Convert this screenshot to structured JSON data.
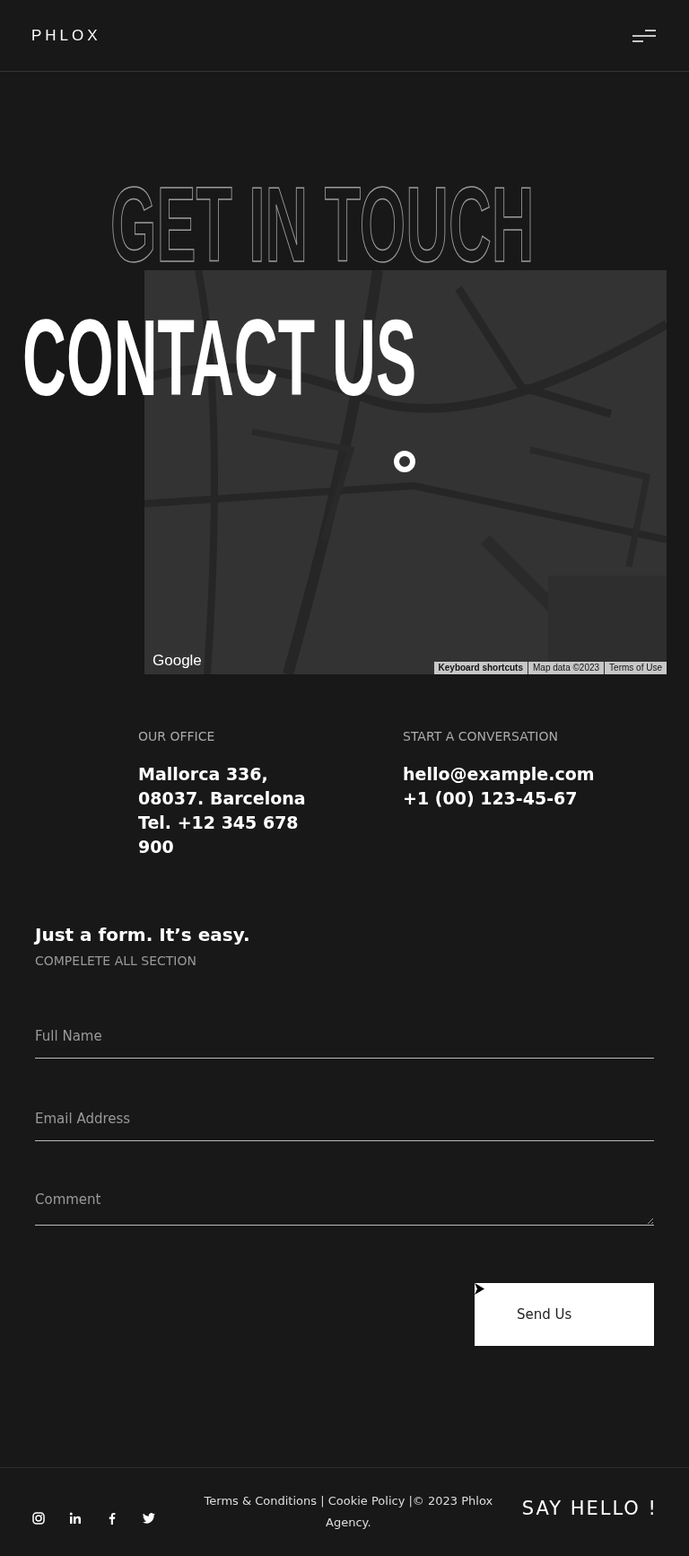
{
  "header": {
    "logo": "PHLOX"
  },
  "hero": {
    "outline_title": "GET IN TOUCH",
    "title": "CONTACT US"
  },
  "map": {
    "kind": "picture",
    "logo": "Google",
    "attribution": [
      "Keyboard shortcuts",
      "Map data ©2023",
      "Terms of Use"
    ]
  },
  "contacts": [
    {
      "label": "OUR OFFICE",
      "lines": [
        "Mallorca 336,",
        "08037. Barcelona",
        "Tel. +12 345 678",
        "900"
      ]
    },
    {
      "label": "START A CONVERSATION",
      "lines": [
        "hello@example.com",
        "+1 (00) 123-45-67"
      ]
    }
  ],
  "form": {
    "title": "Just a form. It’s easy.",
    "subtitle": "COMPELETE ALL SECTION",
    "fields": [
      {
        "kind": "input",
        "placeholder": "Full Name"
      },
      {
        "kind": "input",
        "placeholder": "Email Address"
      },
      {
        "kind": "textarea",
        "placeholder": "Comment"
      }
    ],
    "submit": "Send Us"
  },
  "footer": {
    "social": [
      {
        "kind": "instagram"
      },
      {
        "kind": "linkedin"
      },
      {
        "kind": "facebook"
      },
      {
        "kind": "twitter"
      }
    ],
    "legal": "Terms & Conditions | Cookie Policy |© 2023 Phlox Agency.",
    "cta": "SAY HELLO !"
  }
}
